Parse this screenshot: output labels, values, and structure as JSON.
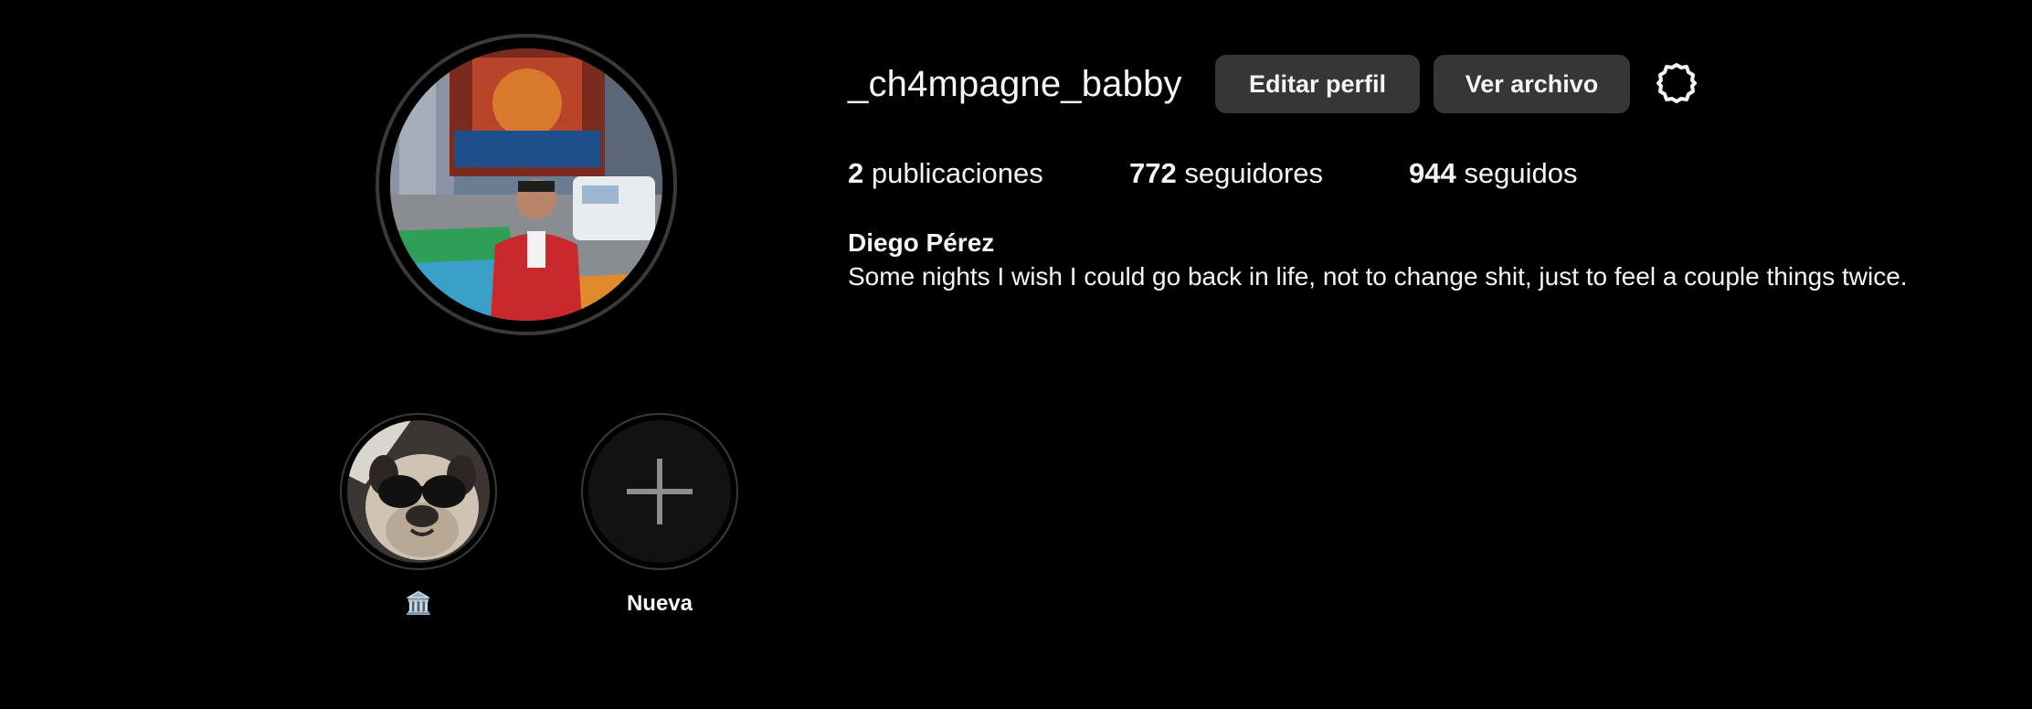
{
  "profile": {
    "username": "_ch4mpagne_babby",
    "full_name": "Diego Pérez",
    "bio": "Some nights I wish I could go back in life, not to change shit, just to feel a couple things twice.",
    "avatar_icon": "profile-photo"
  },
  "actions": {
    "edit_label": "Editar perfil",
    "archive_label": "Ver archivo",
    "settings_icon": "gear-icon"
  },
  "stats": {
    "posts_count": "2",
    "posts_label": "publicaciones",
    "followers_count": "772",
    "followers_label": "seguidores",
    "following_count": "944",
    "following_label": "seguidos"
  },
  "highlights": [
    {
      "label": "🏛️",
      "cover": "pug-with-sunglasses"
    },
    {
      "label": "Nueva",
      "cover": "plus-icon"
    }
  ],
  "colors": {
    "background": "#000000",
    "text": "#f5f5f5",
    "button_bg": "#363636",
    "ring": "#3a3a3a"
  }
}
